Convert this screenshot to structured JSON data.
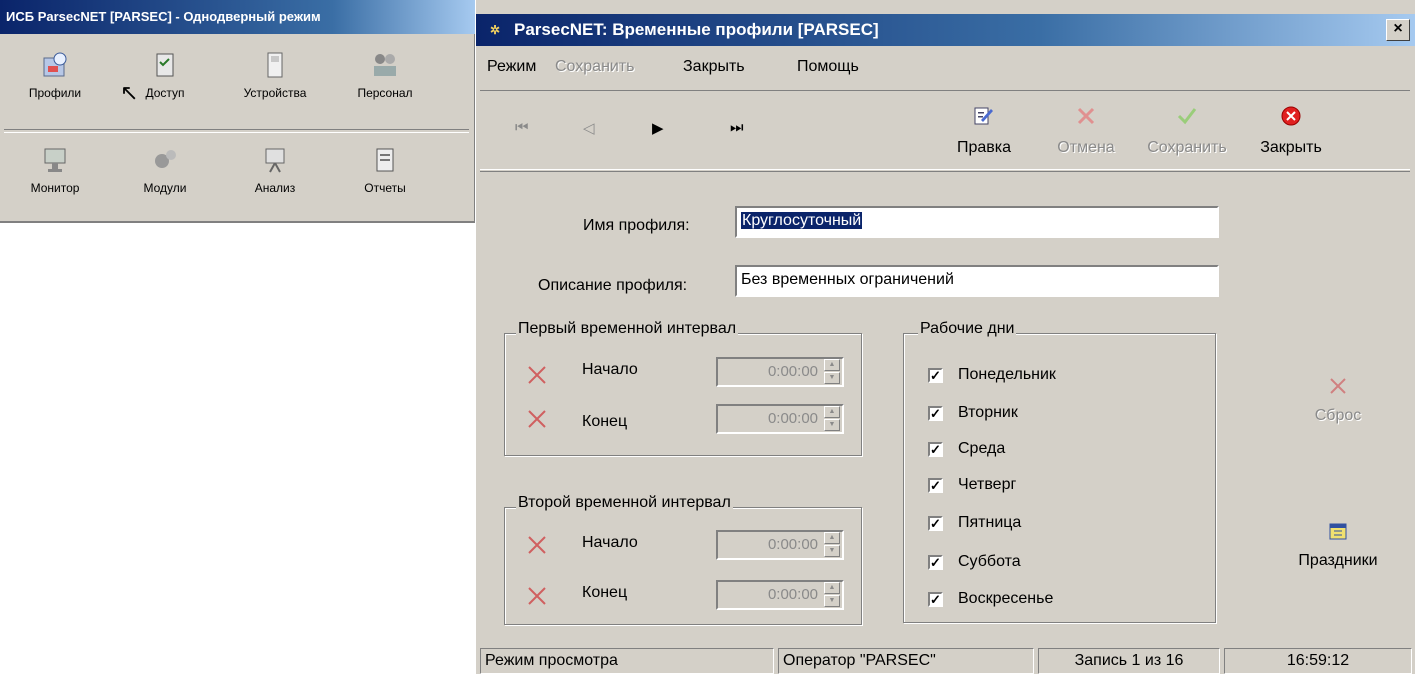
{
  "left_window": {
    "title": "ИСБ ParsecNET [PARSEC] - Однодверный режим",
    "buttons_row1": [
      {
        "label": "Профили",
        "icon": "profiles-icon"
      },
      {
        "label": "Доступ",
        "icon": "access-icon"
      },
      {
        "label": "Устройства",
        "icon": "devices-icon"
      },
      {
        "label": "Персонал",
        "icon": "personnel-icon"
      }
    ],
    "buttons_row2": [
      {
        "label": "Монитор",
        "icon": "monitor-icon"
      },
      {
        "label": "Модули",
        "icon": "modules-icon"
      },
      {
        "label": "Анализ",
        "icon": "analysis-icon"
      },
      {
        "label": "Отчеты",
        "icon": "reports-icon"
      }
    ]
  },
  "main_window": {
    "title": "ParsecNET: Временные профили [PARSEC]",
    "close_glyph": "×",
    "menu": {
      "mode": "Режим",
      "save": "Сохранить",
      "close": "Закрыть",
      "help": "Помощь"
    },
    "nav": {
      "first": "⏮",
      "prev": "◁",
      "next": "▶",
      "last": "⏭"
    },
    "toolbar": {
      "edit": "Правка",
      "cancel": "Отмена",
      "save": "Сохранить",
      "close": "Закрыть"
    },
    "form": {
      "name_label": "Имя профиля:",
      "name_value": "Круглосуточный",
      "desc_label": "Описание профиля:",
      "desc_value": "Без временных ограничений"
    },
    "interval1": {
      "legend": "Первый временной интервал",
      "start_label": "Начало",
      "start_value": "0:00:00",
      "end_label": "Конец",
      "end_value": "0:00:00"
    },
    "interval2": {
      "legend": "Второй временной интервал",
      "start_label": "Начало",
      "start_value": "0:00:00",
      "end_label": "Конец",
      "end_value": "0:00:00"
    },
    "workdays": {
      "legend": "Рабочие дни",
      "check_glyph": "✓",
      "days": [
        {
          "label": "Понедельник",
          "checked": true
        },
        {
          "label": "Вторник",
          "checked": true
        },
        {
          "label": "Среда",
          "checked": true
        },
        {
          "label": "Четверг",
          "checked": true
        },
        {
          "label": "Пятница",
          "checked": true
        },
        {
          "label": "Суббота",
          "checked": true
        },
        {
          "label": "Воскресенье",
          "checked": true
        }
      ]
    },
    "side": {
      "reset": "Сброс",
      "holidays": "Праздники"
    },
    "status": {
      "mode": "Режим просмотра",
      "operator": "Оператор \"PARSEC\"",
      "record": "Запись 1 из 16",
      "time": "16:59:12"
    }
  }
}
